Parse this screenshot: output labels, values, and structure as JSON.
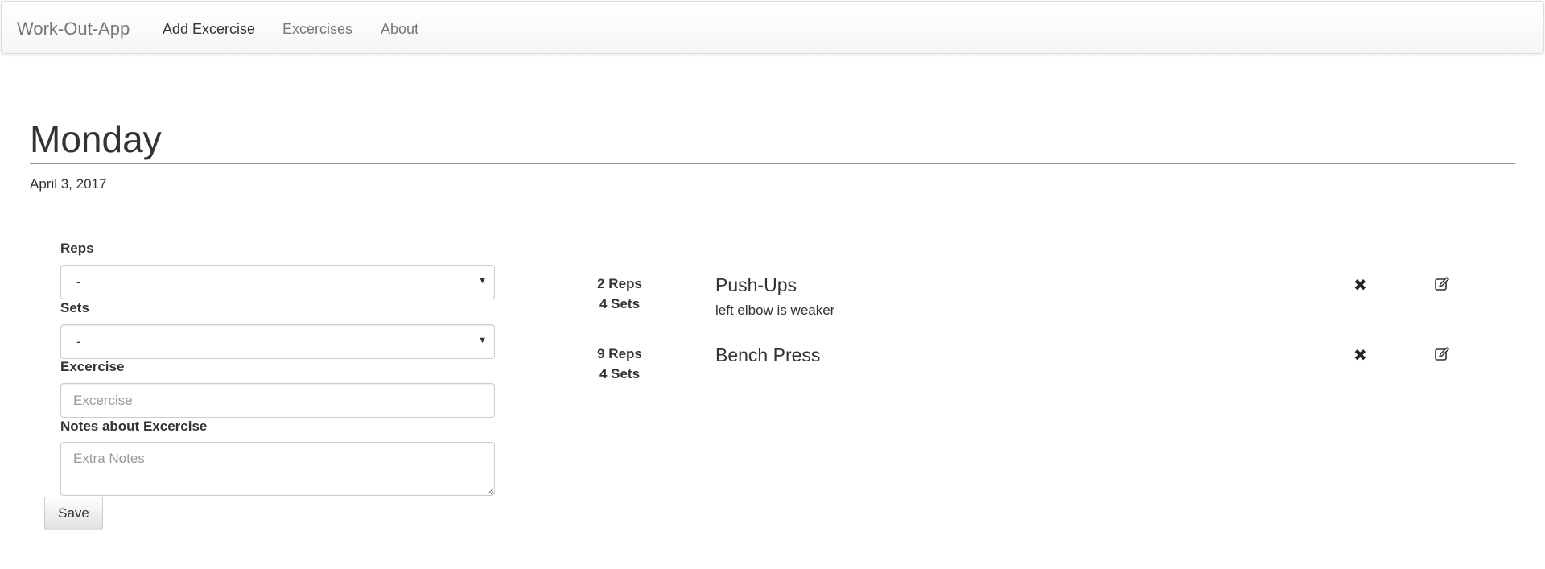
{
  "navbar": {
    "brand": "Work-Out-App",
    "links": [
      {
        "label": "Add Excercise",
        "active": true
      },
      {
        "label": "Excercises",
        "active": false
      },
      {
        "label": "About",
        "active": false
      }
    ]
  },
  "day": {
    "title": "Monday",
    "date": "April 3, 2017"
  },
  "form": {
    "reps_label": "Reps",
    "reps_value": "-",
    "sets_label": "Sets",
    "sets_value": "-",
    "exercise_label": "Excercise",
    "exercise_placeholder": "Excercise",
    "notes_label": "Notes about Excercise",
    "notes_placeholder": "Extra Notes",
    "save_label": "Save"
  },
  "exercises": [
    {
      "reps": "2 Reps",
      "sets": "4 Sets",
      "name": "Push-Ups",
      "notes": "left elbow is weaker"
    },
    {
      "reps": "9 Reps",
      "sets": "4 Sets",
      "name": "Bench Press",
      "notes": ""
    }
  ],
  "icons": {
    "delete": "times-icon",
    "edit": "edit-icon"
  },
  "colors": {
    "text": "#333333",
    "nav_text": "#777777",
    "border": "#cccccc"
  }
}
